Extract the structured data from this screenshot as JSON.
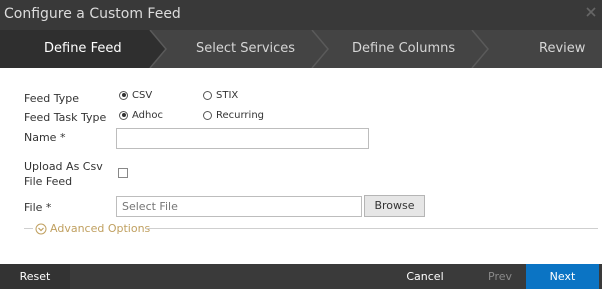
{
  "window": {
    "title": "Configure a Custom Feed"
  },
  "steps": [
    {
      "label": "Define Feed",
      "active": true
    },
    {
      "label": "Select Services",
      "active": false
    },
    {
      "label": "Define Columns",
      "active": false
    },
    {
      "label": "Review",
      "active": false
    }
  ],
  "form": {
    "feed_type": {
      "label": "Feed Type",
      "options": [
        "CSV",
        "STIX"
      ],
      "selected": "CSV"
    },
    "feed_task_type": {
      "label": "Feed Task Type",
      "options": [
        "Adhoc",
        "Recurring"
      ],
      "selected": "Adhoc"
    },
    "name": {
      "label": "Name *",
      "value": ""
    },
    "upload_csv": {
      "label_line1": "Upload As Csv",
      "label_line2": "File Feed",
      "checked": false
    },
    "file": {
      "label": "File *",
      "placeholder": "Select File",
      "browse_label": "Browse"
    },
    "advanced": {
      "label": "Advanced Options"
    }
  },
  "footer": {
    "reset_label": "Reset",
    "cancel_label": "Cancel",
    "prev_label": "Prev",
    "next_label": "Next"
  },
  "colors": {
    "title_bar": "#393939",
    "steps_bar": "#444444",
    "active_step": "#2f2f2f",
    "footer": "#3a3a3a",
    "next_button": "#0b74c4",
    "advanced_text": "#c0a060"
  }
}
